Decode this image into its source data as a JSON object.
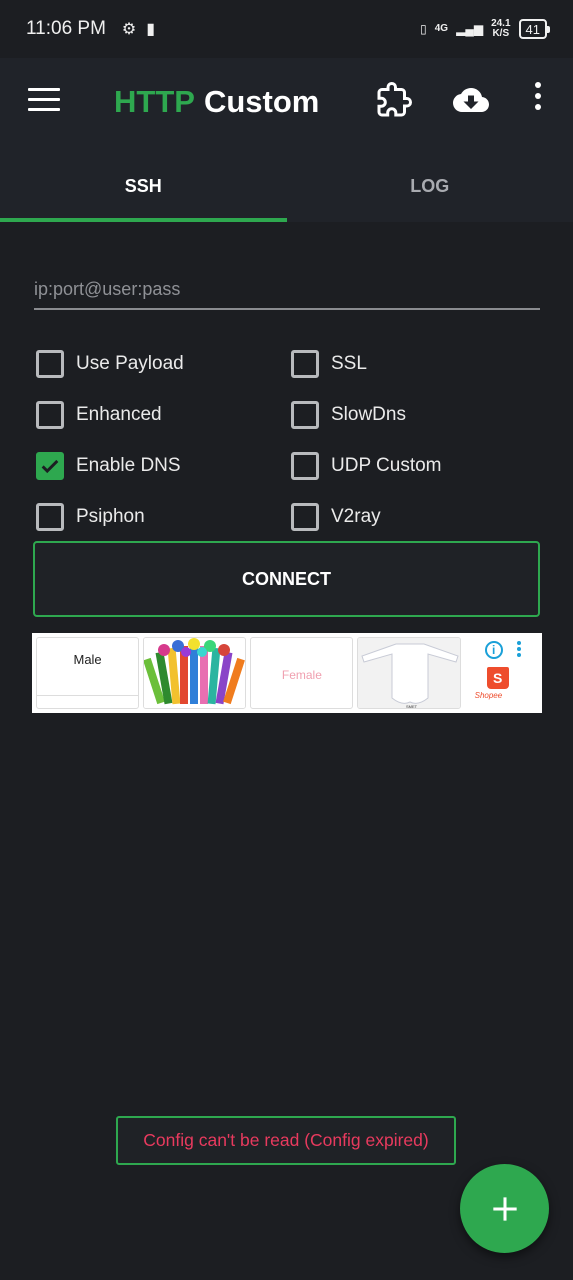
{
  "status_bar": {
    "time": "11:06 PM",
    "network": "4G",
    "speed_value": "24.1",
    "speed_unit": "K/S",
    "battery": "41"
  },
  "app_bar": {
    "title_accent": "HTTP",
    "title_rest": "Custom",
    "icons": [
      "menu-icon",
      "puzzle-icon",
      "cloud-download-icon",
      "more-vert-icon"
    ]
  },
  "tabs": [
    {
      "label": "SSH",
      "active": true
    },
    {
      "label": "LOG",
      "active": false
    }
  ],
  "ssh_input": {
    "placeholder": "ip:port@user:pass",
    "value": ""
  },
  "options": [
    {
      "label": "Use Payload",
      "checked": false
    },
    {
      "label": "SSL",
      "checked": false
    },
    {
      "label": "Enhanced",
      "checked": false
    },
    {
      "label": "SlowDns",
      "checked": false
    },
    {
      "label": "Enable DNS",
      "checked": true
    },
    {
      "label": "UDP Custom",
      "checked": false
    },
    {
      "label": "Psiphon",
      "checked": false
    },
    {
      "label": "V2ray",
      "checked": false
    }
  ],
  "connect_label": "CONNECT",
  "ad": {
    "items": [
      "Male",
      "Female"
    ],
    "brand": "Shopee"
  },
  "toast": "Config can't be read (Config expired)",
  "colors": {
    "accent": "#2ea84f",
    "background": "#1c1e22",
    "toast_text": "#e83a5e"
  }
}
